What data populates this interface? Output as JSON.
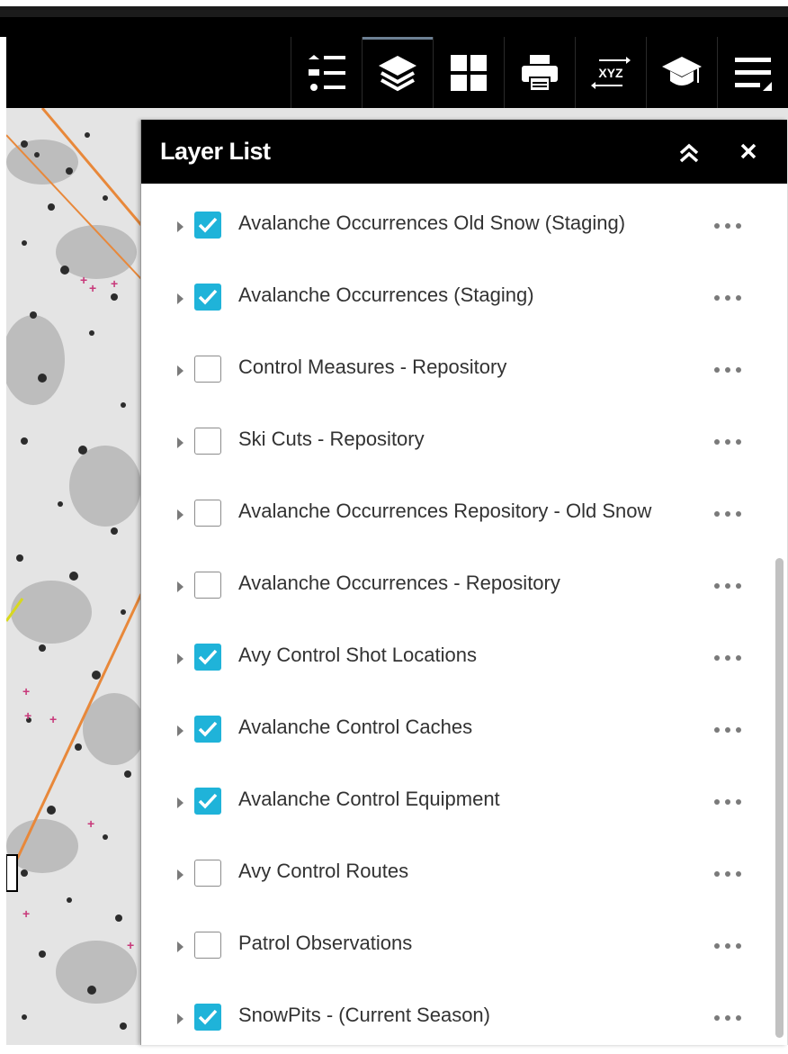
{
  "toolbar": {
    "tools": [
      {
        "icon": "legend-icon",
        "active": false
      },
      {
        "icon": "layers-icon",
        "active": true
      },
      {
        "icon": "basemap-gallery-icon",
        "active": false
      },
      {
        "icon": "print-icon",
        "active": false
      },
      {
        "icon": "coordinate-conversion-icon",
        "label": "XYZ",
        "active": false
      },
      {
        "icon": "about-icon",
        "active": false
      },
      {
        "icon": "more-tools-icon",
        "active": false
      }
    ]
  },
  "panel": {
    "title": "Layer List",
    "collapse_icon": "double-chevron-up-icon",
    "close_icon": "close-icon"
  },
  "layers": [
    {
      "label": "Avalanche Occurrences Old Snow (Staging)",
      "checked": true
    },
    {
      "label": "Avalanche Occurrences (Staging)",
      "checked": true
    },
    {
      "label": "Control Measures - Repository",
      "checked": false
    },
    {
      "label": "Ski Cuts - Repository",
      "checked": false
    },
    {
      "label": "Avalanche Occurrences Repository - Old Snow",
      "checked": false
    },
    {
      "label": "Avalanche Occurrences - Repository",
      "checked": false
    },
    {
      "label": "Avy Control Shot Locations",
      "checked": true
    },
    {
      "label": "Avalanche Control Caches",
      "checked": true
    },
    {
      "label": "Avalanche Control Equipment",
      "checked": true
    },
    {
      "label": "Avy Control Routes",
      "checked": false
    },
    {
      "label": "Patrol Observations",
      "checked": false
    },
    {
      "label": "SnowPits - (Current Season)",
      "checked": true
    }
  ],
  "colors": {
    "checkbox_checked": "#1fb3d9",
    "header_bg": "#000000",
    "text": "#323232"
  }
}
